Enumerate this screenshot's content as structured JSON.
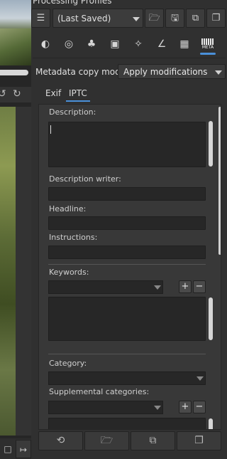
{
  "panel": {
    "title": "Processing Profiles"
  },
  "profile": {
    "selected": "(Last Saved)",
    "icons": {
      "list": "list-icon",
      "open": "folder-icon",
      "save": "save-icon",
      "paste": "paste-icon",
      "copy": "copy-icon"
    }
  },
  "tools": [
    {
      "name": "exposure-icon"
    },
    {
      "name": "detail-icon"
    },
    {
      "name": "color-icon"
    },
    {
      "name": "transform-icon"
    },
    {
      "name": "raw-icon"
    },
    {
      "name": "advanced-icon"
    },
    {
      "name": "favorites-icon"
    },
    {
      "name": "meta-icon",
      "label": "META",
      "active": true
    }
  ],
  "metadata": {
    "copy_mode_label": "Metadata copy mode:",
    "copy_mode_value": "Apply modifications",
    "tabs": [
      {
        "label": "Exif",
        "active": false
      },
      {
        "label": "IPTC",
        "active": true
      }
    ],
    "fields": {
      "description": "Description:",
      "description_writer": "Description writer:",
      "headline": "Headline:",
      "instructions": "Instructions:",
      "keywords": "Keywords:",
      "category": "Category:",
      "supplemental_categories": "Supplemental categories:"
    },
    "add_symbol": "+",
    "remove_symbol": "−"
  },
  "bottom_actions": [
    {
      "name": "reset-icon"
    },
    {
      "name": "import-icon"
    },
    {
      "name": "paste-icon"
    },
    {
      "name": "copy-icon"
    }
  ],
  "accent_color": "#4a90d9"
}
